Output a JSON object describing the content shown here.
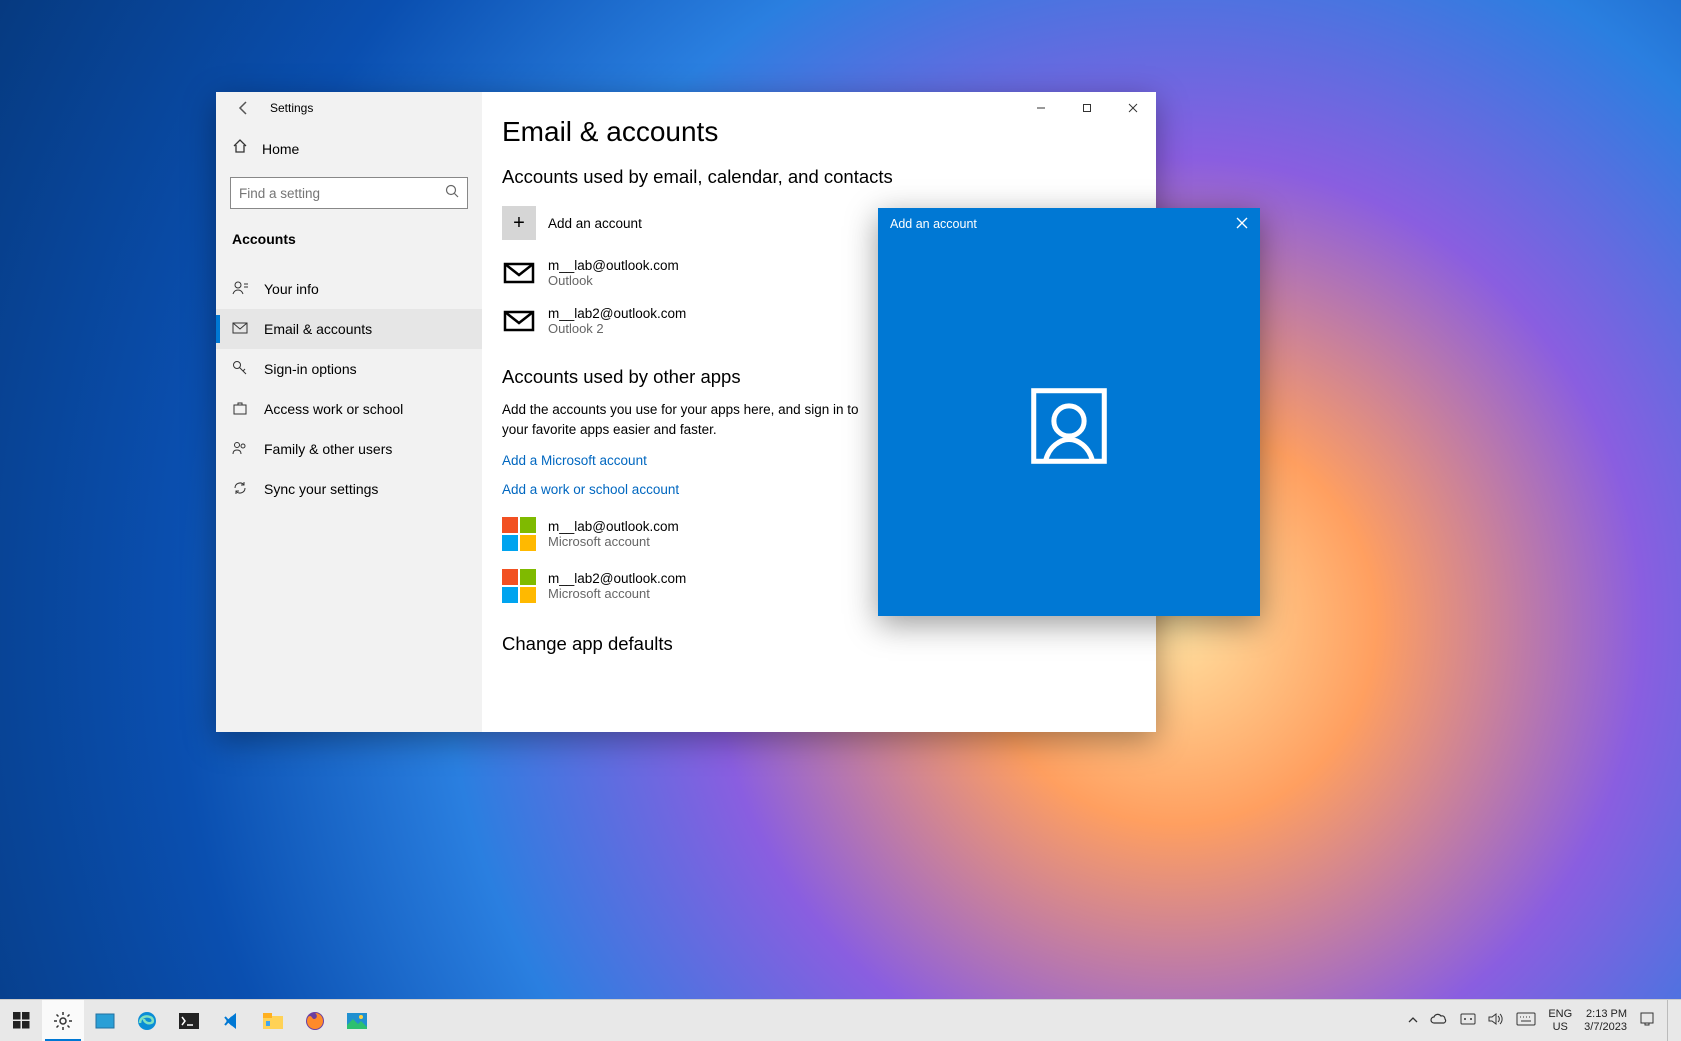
{
  "window": {
    "title": "Settings",
    "home_label": "Home",
    "search_placeholder": "Find a setting",
    "category": "Accounts",
    "nav": [
      {
        "id": "your-info",
        "label": "Your info"
      },
      {
        "id": "email-accounts",
        "label": "Email & accounts"
      },
      {
        "id": "sign-in",
        "label": "Sign-in options"
      },
      {
        "id": "work-school",
        "label": "Access work or school"
      },
      {
        "id": "family",
        "label": "Family & other users"
      },
      {
        "id": "sync",
        "label": "Sync your settings"
      }
    ]
  },
  "page": {
    "title": "Email & accounts",
    "section1_title": "Accounts used by email, calendar, and contacts",
    "add_account_label": "Add an account",
    "mail_accounts": [
      {
        "email": "m__lab@outlook.com",
        "sub": "Outlook"
      },
      {
        "email": "m__lab2@outlook.com",
        "sub": "Outlook 2"
      }
    ],
    "section2_title": "Accounts used by other apps",
    "section2_body": "Add the accounts you use for your apps here, and sign in to your favorite apps easier and faster.",
    "link_ms": "Add a Microsoft account",
    "link_work": "Add a work or school account",
    "app_accounts": [
      {
        "email": "m__lab@outlook.com",
        "sub": "Microsoft account"
      },
      {
        "email": "m__lab2@outlook.com",
        "sub": "Microsoft account"
      }
    ],
    "section3_title": "Change app defaults"
  },
  "modal": {
    "title": "Add an account"
  },
  "taskbar": {
    "lang1": "ENG",
    "lang2": "US",
    "time": "2:13 PM",
    "date": "3/7/2023"
  }
}
